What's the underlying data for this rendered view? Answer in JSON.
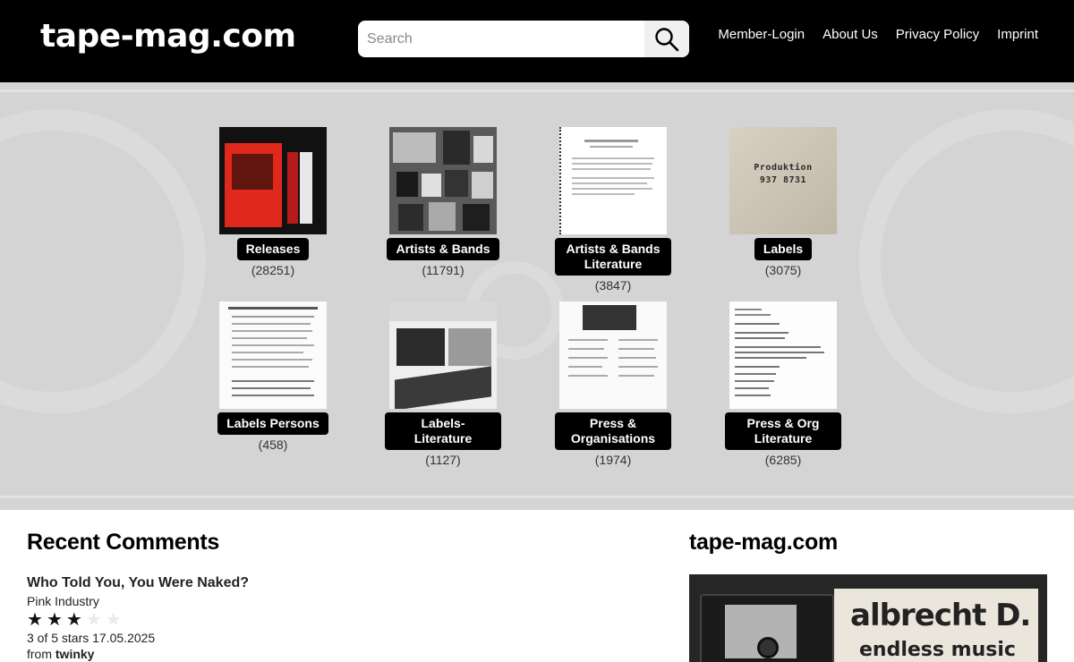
{
  "header": {
    "logo": "tape-mag.com",
    "search_placeholder": "Search",
    "nav": [
      "Member-Login",
      "About Us",
      "Privacy Policy",
      "Imprint"
    ]
  },
  "categories": [
    {
      "label": "Releases",
      "count": "(28251)"
    },
    {
      "label": "Artists & Bands",
      "count": "(11791)"
    },
    {
      "label": "Artists & Bands Literature",
      "count": "(3847)"
    },
    {
      "label": "Labels",
      "count": "(3075)"
    },
    {
      "label": "Labels Persons",
      "count": "(458)"
    },
    {
      "label": "Labels-Literature",
      "count": "(1127)"
    },
    {
      "label": "Press & Organisations",
      "count": "(1974)"
    },
    {
      "label": "Press & Org Literature",
      "count": "(6285)"
    }
  ],
  "thumb_texts": {
    "labels_card": [
      "Produktion",
      "937 8731"
    ]
  },
  "comments": {
    "heading": "Recent Comments",
    "items": [
      {
        "title": "Who Told You, You Were Naked?",
        "artist": "Pink Industry",
        "rating": 3,
        "max": 5,
        "meta": "3 of 5 stars 17.05.2025",
        "from_prefix": "from",
        "user": "twinky"
      }
    ]
  },
  "promo": {
    "heading": "tape-mag.com",
    "brand": "albrecht D.",
    "sub": "endless music"
  },
  "colors": {
    "header_bg": "#000000",
    "hero_bg": "#d4d4d4",
    "tag_bg": "#000000"
  }
}
